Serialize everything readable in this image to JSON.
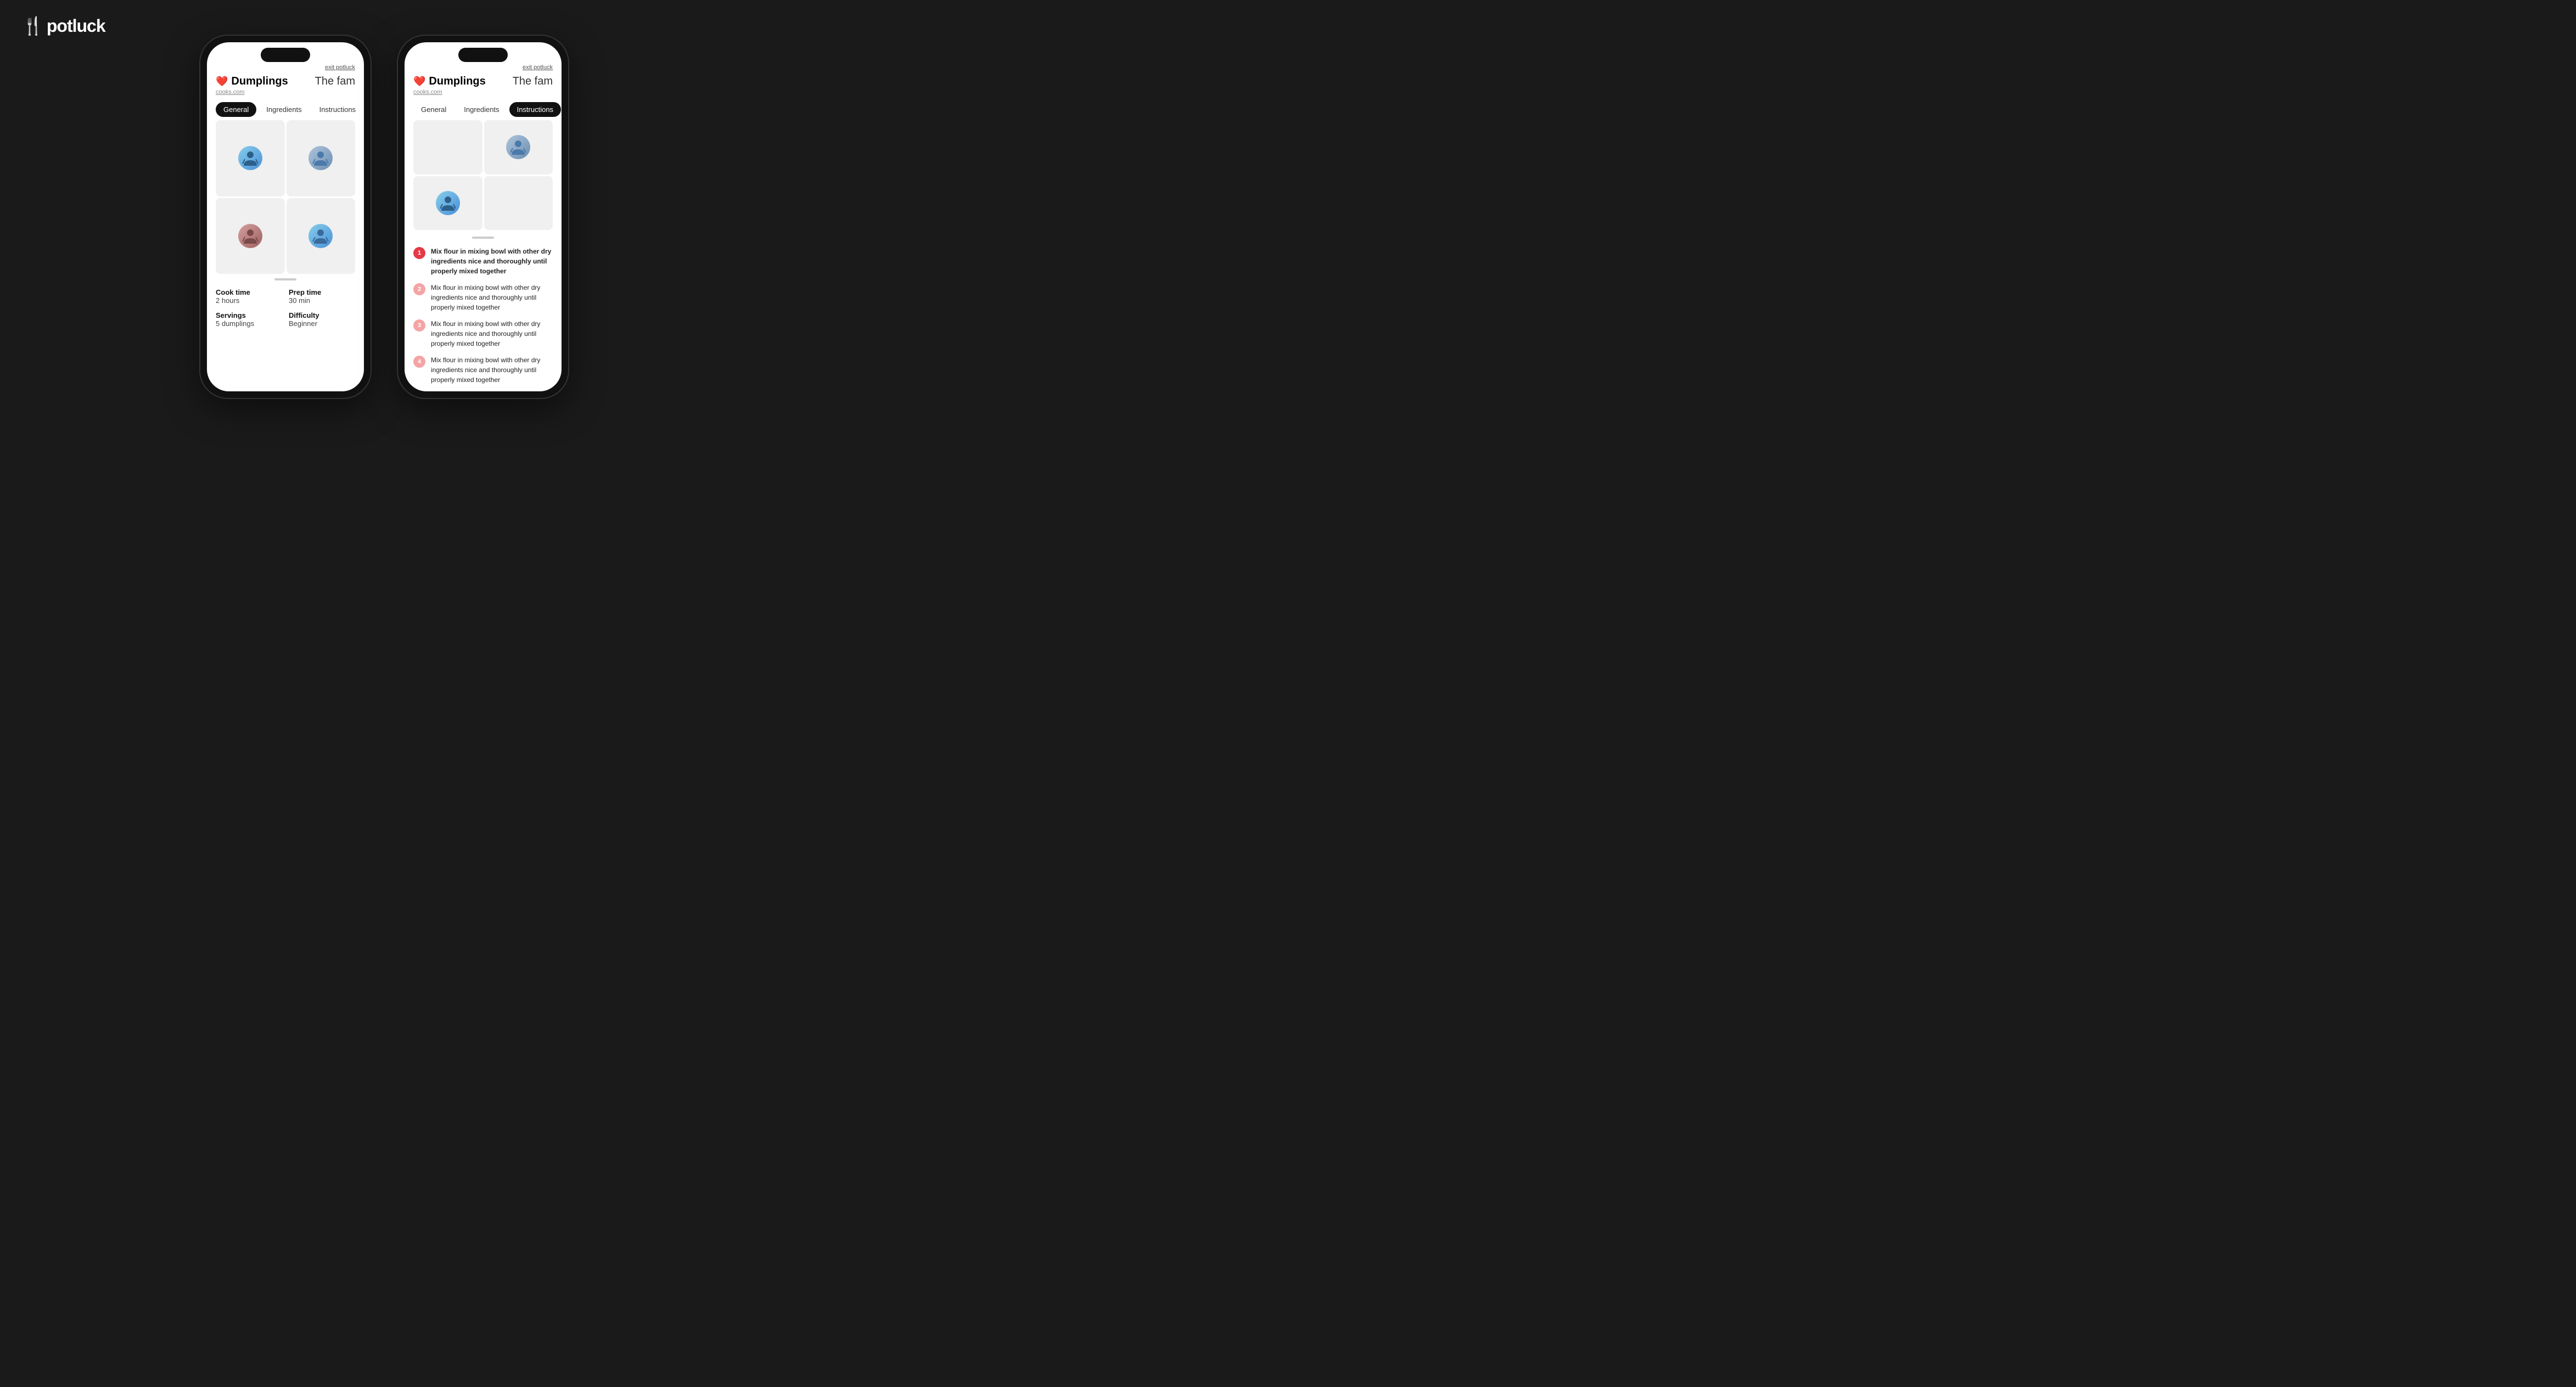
{
  "app": {
    "logo": "potluck",
    "logo_icon": "🍴"
  },
  "phone1": {
    "exit_label": "exit potluck",
    "recipe_title": "Dumplings",
    "group_name": "The fam",
    "source": "cooks.com",
    "tabs": [
      {
        "id": "general",
        "label": "General",
        "active": true
      },
      {
        "id": "ingredients",
        "label": "Ingredients",
        "active": false
      },
      {
        "id": "instructions",
        "label": "Instructions",
        "active": false
      }
    ],
    "general": {
      "cook_time_label": "Cook time",
      "cook_time_value": "2 hours",
      "prep_time_label": "Prep time",
      "prep_time_value": "30 min",
      "servings_label": "Servings",
      "servings_value": "5 dumplings",
      "difficulty_label": "Difficulty",
      "difficulty_value": "Beginner"
    }
  },
  "phone2": {
    "exit_label": "exit potluck",
    "recipe_title": "Dumplings",
    "group_name": "The fam",
    "source": "cooks.com",
    "tabs": [
      {
        "id": "general",
        "label": "General",
        "active": false
      },
      {
        "id": "ingredients",
        "label": "Ingredients",
        "active": false
      },
      {
        "id": "instructions",
        "label": "Instructions",
        "active": true
      }
    ],
    "instructions": [
      {
        "step": 1,
        "active": true,
        "text": "Mix flour in mixing bowl with other dry ingredients nice and thoroughly until properly mixed together"
      },
      {
        "step": 2,
        "active": false,
        "text": "Mix flour in mixing bowl with other dry ingredients nice and thoroughly until properly mixed together"
      },
      {
        "step": 3,
        "active": false,
        "text": "Mix flour in mixing bowl with other dry ingredients nice and thoroughly until properly mixed together"
      },
      {
        "step": 4,
        "active": false,
        "text": "Mix flour in mixing bowl with other dry ingredients nice and thoroughly until properly mixed together"
      }
    ]
  }
}
